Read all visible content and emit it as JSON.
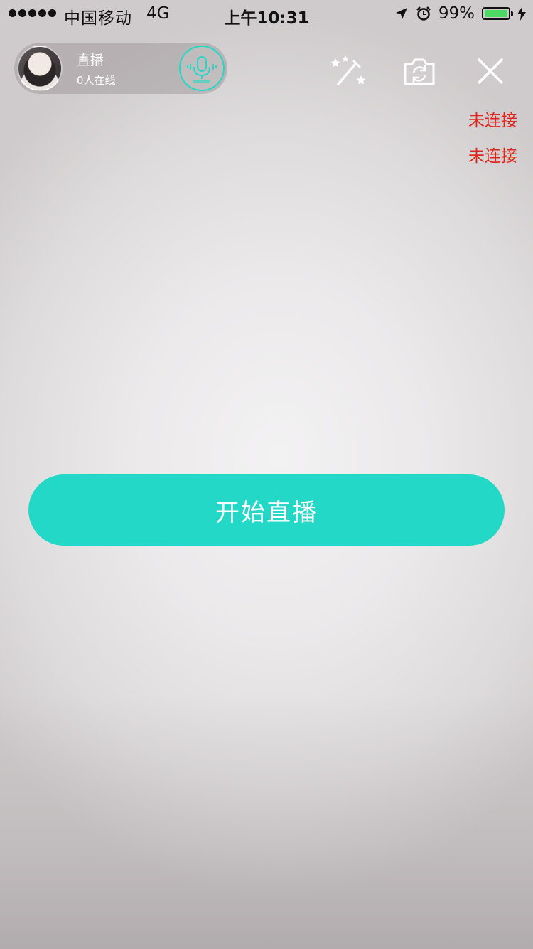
{
  "status_bar": {
    "carrier": "中国移动",
    "network": "4G",
    "time": "上午10:31",
    "battery_percent_label": "99%",
    "battery_level": 0.99,
    "icons": [
      "location-arrow-icon",
      "alarm-clock-icon",
      "battery-icon",
      "charging-bolt-icon"
    ]
  },
  "host": {
    "title": "直播",
    "online_text": "0人在线",
    "mic_icon": "microphone-icon"
  },
  "toolbar": {
    "icons": [
      "magic-wand-icon",
      "camera-switch-icon",
      "close-icon"
    ]
  },
  "connections": {
    "status_1": "未连接",
    "status_2": "未连接"
  },
  "actions": {
    "start_label": "开始直播"
  },
  "colors": {
    "accent": "#24d8c8",
    "error": "#e0261c",
    "battery": "#4cd964"
  }
}
